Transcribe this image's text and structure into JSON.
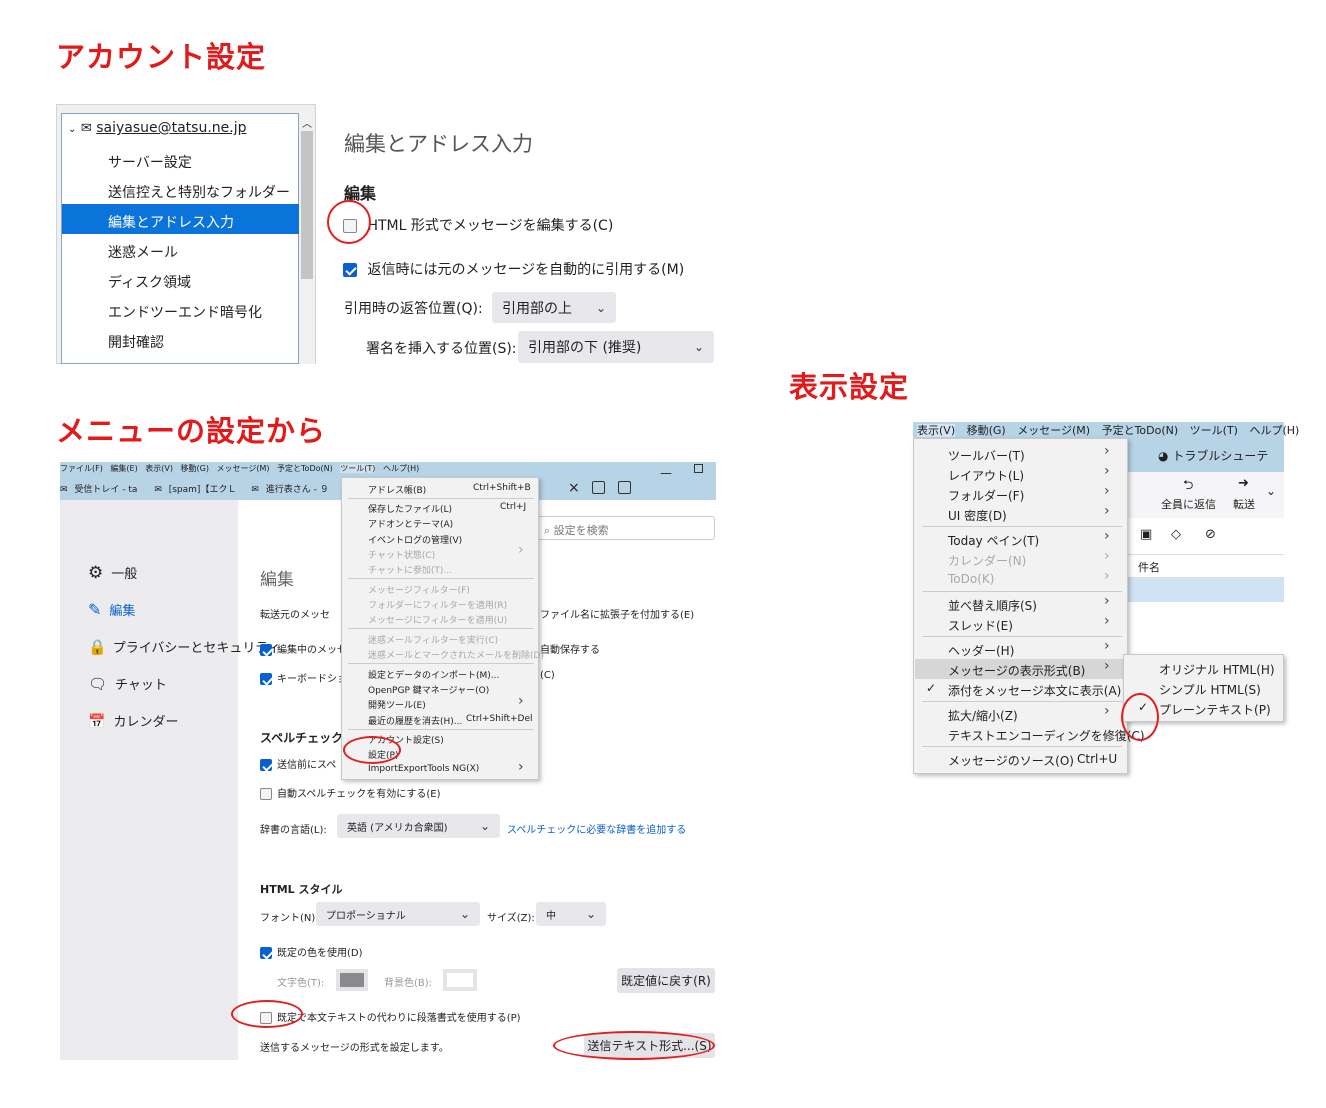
{
  "headings": {
    "account": "アカウント設定",
    "menu": "メニューの設定から",
    "view": "表示設定"
  },
  "account_panel": {
    "account": "saiyasue@tatsu.ne.jp",
    "tree_items": [
      "サーバー設定",
      "送信控えと特別なフォルダー",
      "編集とアドレス入力",
      "迷惑メール",
      "ディスク領域",
      "エンドツーエンド暗号化",
      "開封確認"
    ],
    "page_title": "編集とアドレス入力",
    "section": "編集",
    "opt_html": "HTML 形式でメッセージを編集する(C)",
    "opt_quote": "返信時には元のメッセージを自動的に引用する(M)",
    "reply_pos_label": "引用時の返答位置(Q):",
    "reply_pos_value": "引用部の上",
    "sig_pos_label": "署名を挿入する位置(S):",
    "sig_pos_value": "引用部の下 (推奨)"
  },
  "settings_window": {
    "menubar": [
      "ファイル(F)",
      "編集(E)",
      "表示(V)",
      "移動(G)",
      "メッセージ(M)",
      "予定とToDo(N)",
      "ツール(T)",
      "ヘルプ(H)"
    ],
    "tabs": [
      "受信トレイ - ta",
      "[spam]【エクＬ",
      "進行表さん - ９"
    ],
    "tab_close": "×",
    "search_placeholder": "設定を検索",
    "nav": [
      "一般",
      "編集",
      "プライバシーとセキュリティ",
      "チャット",
      "カレンダー"
    ],
    "section_edit": "編集",
    "forward_label": "転送元のメッセ",
    "ext_label": "ファイル名に拡張子を付加する(E)",
    "draft_label": "編集中のメッセ",
    "autosave_label": "自動保存する",
    "keyboard_label": "キーボードショー",
    "keyboard_tail": "(C)",
    "spell_title": "スペルチェック",
    "spell_send": "送信前にスペ",
    "spell_auto": "自動スペルチェックを有効にする(E)",
    "dict_label": "辞書の言語(L):",
    "dict_value": "英語 (アメリカ合衆国)",
    "dict_link": "スペルチェックに必要な辞書を追加する",
    "html_title": "HTML スタイル",
    "font_label": "フォント(N):",
    "font_value": "プロポーショナル",
    "size_label": "サイズ(Z):",
    "size_value": "中",
    "default_color": "既定の色を使用(D)",
    "text_color": "文字色(T):",
    "bg_color": "背景色(B):",
    "reset_btn": "既定値に戻す(R)",
    "para_label": "既定で本文テキストの代わりに段落書式を使用する(P)",
    "send_format_label": "送信するメッセージの形式を設定します。",
    "send_format_btn": "送信テキスト形式...(S)"
  },
  "tools_menu": {
    "items": [
      {
        "label": "アドレス帳(B)",
        "shortcut": "Ctrl+Shift+B"
      },
      {
        "label": "保存したファイル(L)",
        "shortcut": "Ctrl+J"
      },
      {
        "label": "アドオンとテーマ(A)",
        "shortcut": ""
      },
      {
        "label": "イベントログの管理(V)",
        "shortcut": ""
      },
      {
        "label": "チャット状態(C)",
        "shortcut": ""
      },
      {
        "label": "チャットに参加(T)...",
        "shortcut": ""
      },
      {
        "label": "メッセージフィルター(F)",
        "shortcut": ""
      },
      {
        "label": "フォルダーにフィルターを適用(R)",
        "shortcut": ""
      },
      {
        "label": "メッセージにフィルターを適用(U)",
        "shortcut": ""
      },
      {
        "label": "迷惑メールフィルターを実行(C)",
        "shortcut": ""
      },
      {
        "label": "迷惑メールとマークされたメールを削除(D)",
        "shortcut": ""
      },
      {
        "label": "設定とデータのインポート(M)...",
        "shortcut": ""
      },
      {
        "label": "OpenPGP 鍵マネージャー(O)",
        "shortcut": ""
      },
      {
        "label": "開発ツール(E)",
        "shortcut": ""
      },
      {
        "label": "最近の履歴を消去(H)...",
        "shortcut": "Ctrl+Shift+Del"
      },
      {
        "label": "アカウント設定(S)",
        "shortcut": ""
      },
      {
        "label": "設定(P)",
        "shortcut": ""
      },
      {
        "label": "ImportExportTools NG(X)",
        "shortcut": ""
      }
    ]
  },
  "view_window": {
    "menubar": [
      "表示(V)",
      "移動(G)",
      "メッセージ(M)",
      "予定とToDo(N)",
      "ツール(T)",
      "ヘルプ(H)"
    ],
    "tab": "トラブルシューテ",
    "reply_all": "全員に返信",
    "forward": "転送",
    "subject": "件名",
    "view_menu": [
      {
        "label": "ツールバー(T)"
      },
      {
        "label": "レイアウト(L)"
      },
      {
        "label": "フォルダー(F)"
      },
      {
        "label": "UI 密度(D)"
      },
      {
        "label": "Today ペイン(T)"
      },
      {
        "label": "カレンダー(N)"
      },
      {
        "label": "ToDo(K)"
      },
      {
        "label": "並べ替え順序(S)"
      },
      {
        "label": "スレッド(E)"
      },
      {
        "label": "ヘッダー(H)"
      },
      {
        "label": "メッセージの表示形式(B)"
      },
      {
        "label": "添付をメッセージ本文に表示(A)"
      },
      {
        "label": "拡大/縮小(Z)"
      },
      {
        "label": "テキストエンコーディングを修復(C)"
      },
      {
        "label": "メッセージのソース(O)",
        "shortcut": "Ctrl+U"
      }
    ],
    "submenu": [
      "オリジナル HTML(H)",
      "シンプル HTML(S)",
      "プレーンテキスト(P)"
    ]
  }
}
